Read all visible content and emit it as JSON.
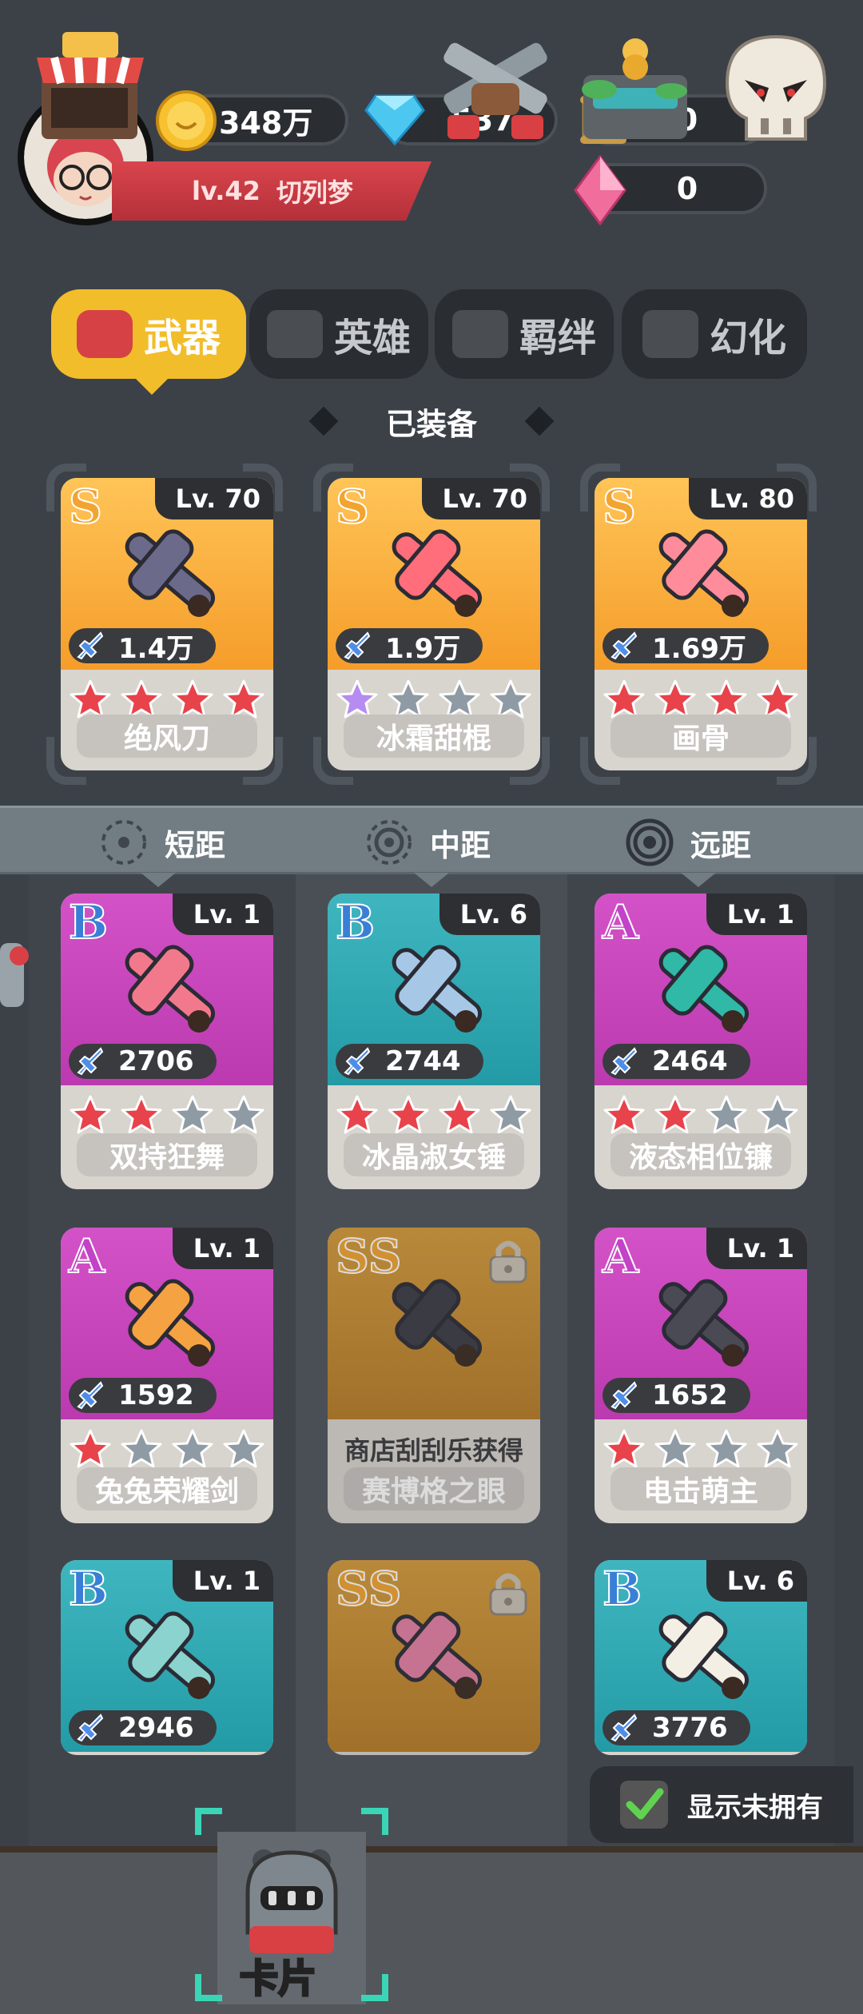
{
  "player": {
    "level_label": "lv.42",
    "name": "切列梦"
  },
  "resources": {
    "gold": "348万",
    "diamond": "537",
    "scroll": "0",
    "crystal": "0"
  },
  "tabs": [
    {
      "label": "武器",
      "active": true
    },
    {
      "label": "英雄",
      "active": false
    },
    {
      "label": "羁绊",
      "active": false
    },
    {
      "label": "幻化",
      "active": false
    }
  ],
  "equipped_title": "已装备",
  "equipped": [
    {
      "grade": "S",
      "level": "Lv. 70",
      "power": "1.4万",
      "stars_filled": 4,
      "star_color": "red",
      "name": "绝风刀"
    },
    {
      "grade": "S",
      "level": "Lv. 70",
      "power": "1.9万",
      "stars_filled": 1,
      "star_color": "purple",
      "name": "冰霜甜棍"
    },
    {
      "grade": "S",
      "level": "Lv. 80",
      "power": "1.69万",
      "stars_filled": 4,
      "star_color": "red",
      "name": "画骨"
    }
  ],
  "ranges": [
    "短距",
    "中距",
    "远距"
  ],
  "grid": [
    {
      "grade": "B",
      "level": "Lv. 1",
      "power": "2706",
      "stars_filled": 2,
      "name": "双持狂舞",
      "bg": "pink"
    },
    {
      "grade": "B",
      "level": "Lv. 6",
      "power": "2744",
      "stars_filled": 3,
      "name": "冰晶淑女锤",
      "bg": "teal"
    },
    {
      "grade": "A",
      "level": "Lv. 1",
      "power": "2464",
      "stars_filled": 2,
      "name": "液态相位镰",
      "bg": "pink"
    },
    {
      "grade": "A",
      "level": "Lv. 1",
      "power": "1592",
      "stars_filled": 1,
      "name": "兔兔荣耀剑",
      "bg": "pink"
    },
    {
      "grade": "SS",
      "locked": true,
      "acquire": "商店刮刮乐获得",
      "name": "赛博格之眼",
      "bg": "gold"
    },
    {
      "grade": "A",
      "level": "Lv. 1",
      "power": "1652",
      "stars_filled": 1,
      "name": "电击萌主",
      "bg": "pink"
    },
    {
      "grade": "B",
      "level": "Lv. 1",
      "power": "2946",
      "bg": "teal"
    },
    {
      "grade": "SS",
      "locked": true,
      "bg": "gold"
    },
    {
      "grade": "B",
      "level": "Lv. 6",
      "power": "3776",
      "bg": "teal"
    }
  ],
  "show_unowned": {
    "label": "显示未拥有",
    "checked": true
  },
  "nav": {
    "active_label": "卡片"
  },
  "colors": {
    "accent": "#f2bd2a",
    "star_red": "#e8424a",
    "star_purple": "#b68cf0",
    "star_empty": "#8e9aa4"
  }
}
